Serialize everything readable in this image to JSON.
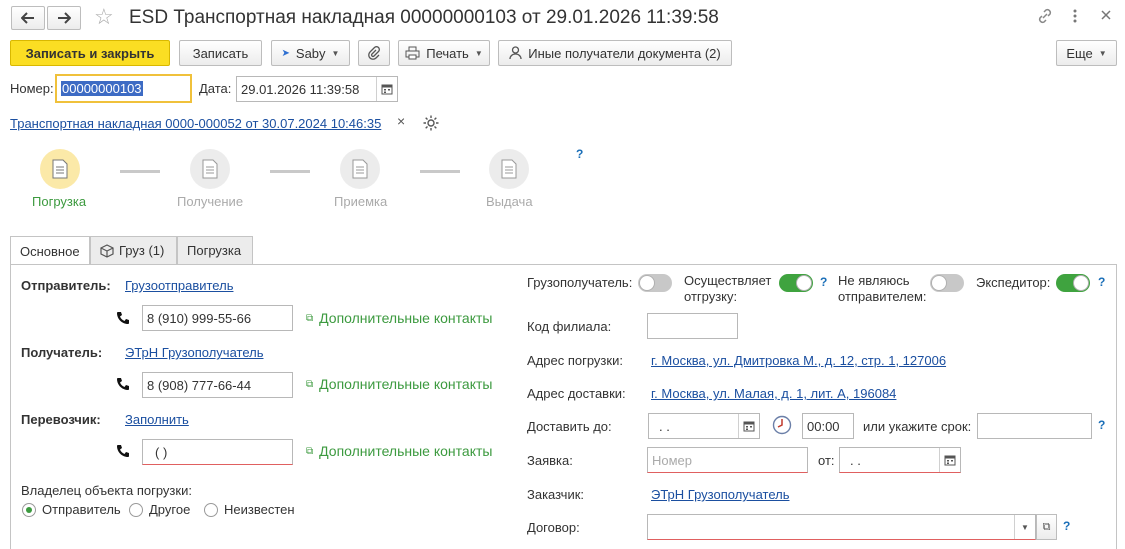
{
  "window": {
    "title": "ESD Транспортная накладная 00000000103 от 29.01.2026 11:39:58"
  },
  "toolbar": {
    "write_close": "Записать и закрыть",
    "write": "Записать",
    "saby": "Saby",
    "print": "Печать",
    "other_recipients": "Иные получатели документа (2)",
    "more": "Еще"
  },
  "header": {
    "number_label": "Номер:",
    "number_value": "00000000103",
    "date_label": "Дата:",
    "date_value": "29.01.2026 11:39:58",
    "base_doc_link": "Транспортная накладная 0000-000052 от 30.07.2024 10:46:35",
    "clear": "×"
  },
  "stages": {
    "help": "?",
    "items": [
      {
        "label": "Погрузка"
      },
      {
        "label": "Получение"
      },
      {
        "label": "Приемка"
      },
      {
        "label": "Выдача"
      }
    ]
  },
  "tabs": [
    {
      "label": "Основное"
    },
    {
      "label": "Груз (1)"
    },
    {
      "label": "Погрузка"
    }
  ],
  "left": {
    "sender_label": "Отправитель:",
    "sender_value": "Грузоотправитель",
    "sender_phone": "8 (910) 999-55-66",
    "recipient_label": "Получатель:",
    "recipient_value": "ЭТрН Грузополучатель",
    "recipient_phone": "8 (908) 777-66-44",
    "carrier_label": "Перевозчик:",
    "carrier_value": "Заполнить",
    "carrier_phone": "(  )",
    "extra_contacts": "Дополнительные контакты",
    "owner_label": "Владелец объекта погрузки:",
    "owner_options": [
      "Отправитель",
      "Другое",
      "Неизвестен"
    ],
    "owner_selected": "Отправитель"
  },
  "right": {
    "consignee_label": "Грузополучатель:",
    "ships_label_1": "Осуществляет",
    "ships_label_2": "отгрузку:",
    "not_sender_label_1": "Не являюсь",
    "not_sender_label_2": "отправителем:",
    "forwarder_label": "Экспедитор:",
    "branch_code_label": "Код филиала:",
    "branch_code_value": "",
    "load_address_label": "Адрес погрузки:",
    "load_address_value": "г. Москва, ул. Дмитровка М., д. 12, стр. 1, 127006",
    "delivery_address_label": "Адрес доставки:",
    "delivery_address_value": "г. Москва, ул. Малая, д. 1, лит. А, 196084",
    "deliver_by_label": "Доставить до:",
    "deliver_by_date": " .  .",
    "deliver_by_time": "00:00",
    "term_label": "или укажите срок:",
    "term_value": "",
    "request_label": "Заявка:",
    "request_placeholder": "Номер",
    "from_label": "от:",
    "from_date": " .  .",
    "customer_label": "Заказчик:",
    "customer_value": "ЭТрН Грузополучатель",
    "contract_label": "Договор:",
    "contract_value": "",
    "help": "?"
  },
  "toggles": {
    "consignee": false,
    "ships": true,
    "not_sender": false,
    "forwarder": true
  },
  "colors": {
    "primary_button": "#fbde23",
    "link": "#1b4fa0",
    "green": "#3c9a3f",
    "active_stage": "#fbe9a8"
  }
}
